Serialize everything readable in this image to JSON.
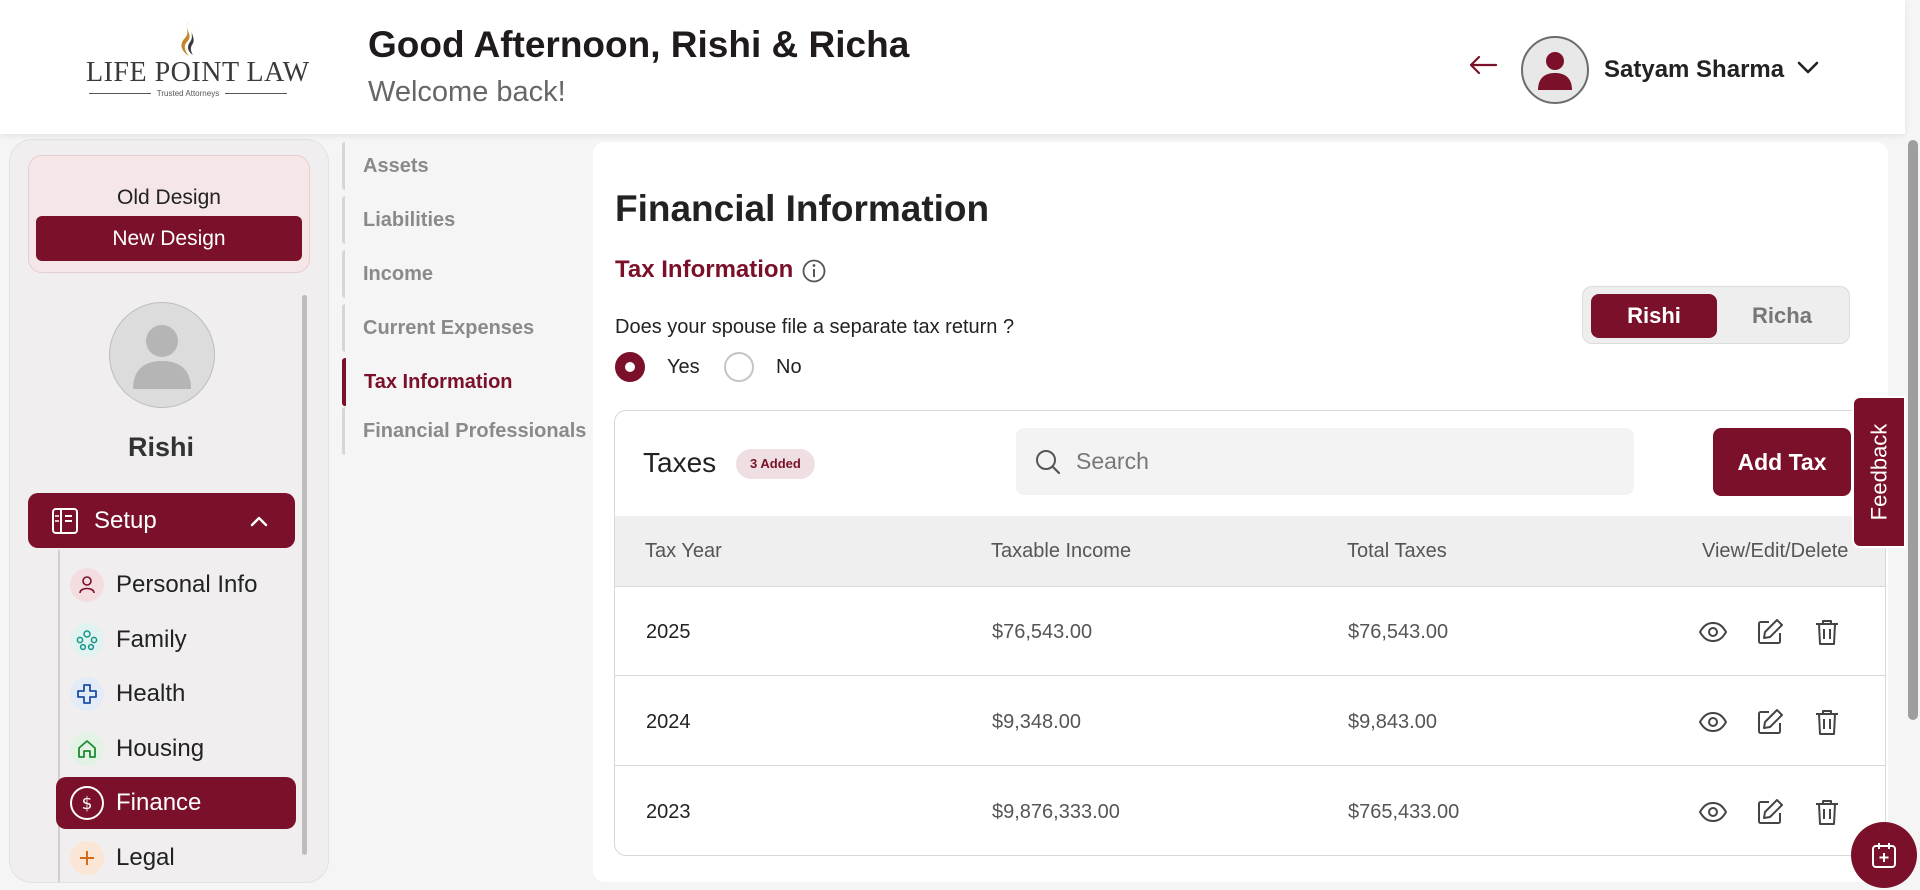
{
  "brand": {
    "name": "LIFE POINT LAW",
    "tagline": "Trusted Attorneys"
  },
  "header": {
    "greeting": "Good Afternoon, Rishi & Richa",
    "subtitle": "Welcome back!",
    "user_name": "Satyam Sharma"
  },
  "sidebar": {
    "old_design": "Old Design",
    "new_design": "New Design",
    "profile_name": "Rishi",
    "setup_label": "Setup",
    "items": [
      {
        "label": "Personal Info",
        "icon": "person-icon"
      },
      {
        "label": "Family",
        "icon": "family-icon"
      },
      {
        "label": "Health",
        "icon": "health-icon"
      },
      {
        "label": "Housing",
        "icon": "home-icon"
      },
      {
        "label": "Finance",
        "icon": "dollar-icon"
      },
      {
        "label": "Legal",
        "icon": "legal-icon"
      }
    ]
  },
  "section_nav": {
    "items": [
      "Assets",
      "Liabilities",
      "Income",
      "Current Expenses",
      "Tax Information",
      "Financial Professionals"
    ],
    "active": "Tax Information"
  },
  "main": {
    "title": "Financial Information",
    "section_title": "Tax Information",
    "question": "Does your spouse file a separate tax return ?",
    "options": {
      "yes": "Yes",
      "no": "No"
    },
    "selected": "Yes",
    "toggle": {
      "a": "Rishi",
      "b": "Richa",
      "active": "Rishi"
    }
  },
  "taxes": {
    "title": "Taxes",
    "badge": "3 Added",
    "search_placeholder": "Search",
    "add_button": "Add Tax",
    "columns": [
      "Tax Year",
      "Taxable Income",
      "Total Taxes",
      "View/Edit/Delete"
    ],
    "rows": [
      {
        "year": "2025",
        "taxable_income": "$76,543.00",
        "total_taxes": "$76,543.00"
      },
      {
        "year": "2024",
        "taxable_income": "$9,348.00",
        "total_taxes": "$9,843.00"
      },
      {
        "year": "2023",
        "taxable_income": "$9,876,333.00",
        "total_taxes": "$765,433.00"
      }
    ]
  },
  "feedback_label": "Feedback",
  "colors": {
    "accent": "#7a1029"
  }
}
